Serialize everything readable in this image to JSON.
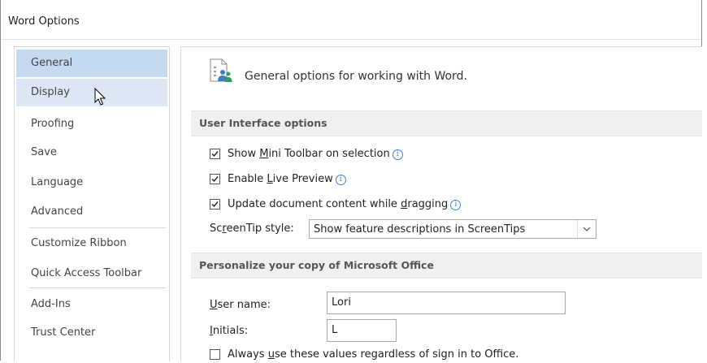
{
  "window": {
    "title": "Word Options"
  },
  "sidebar": {
    "items": [
      {
        "label": "General"
      },
      {
        "label": "Display"
      },
      {
        "label": "Proofing"
      },
      {
        "label": "Save"
      },
      {
        "label": "Language"
      },
      {
        "label": "Advanced"
      },
      {
        "label": "Customize Ribbon"
      },
      {
        "label": "Quick Access Toolbar"
      },
      {
        "label": "Add-Ins"
      },
      {
        "label": "Trust Center"
      }
    ],
    "selected": "General",
    "hovered": "Display"
  },
  "main": {
    "heading": "General options for working with Word.",
    "ui_section": {
      "title": "User Interface options",
      "mini_toolbar": {
        "pre": "Show ",
        "key": "M",
        "post": "ini Toolbar on selection",
        "checked": true
      },
      "live_preview": {
        "pre": "Enable ",
        "key": "L",
        "post": "ive Preview",
        "checked": true
      },
      "update_dragging": {
        "pre": "Update document content while ",
        "key": "d",
        "post": "ragging",
        "checked": true
      },
      "screentip": {
        "pre": "Sc",
        "key": "r",
        "post": "eenTip style:",
        "value": "Show feature descriptions in ScreenTips"
      }
    },
    "personalize_section": {
      "title": "Personalize your copy of Microsoft Office",
      "user_name": {
        "key": "U",
        "post": "ser name:",
        "value": "Lori"
      },
      "initials": {
        "key": "I",
        "post": "nitials:",
        "value": "L"
      },
      "always_use": {
        "pre": "Always ",
        "key": "u",
        "post": "se these values regardless of sign in to Office.",
        "checked": false
      }
    }
  },
  "colors": {
    "selected_bg": "#c5d9f1",
    "hover_bg": "#dce6f4",
    "info_blue": "#3a80d6"
  }
}
